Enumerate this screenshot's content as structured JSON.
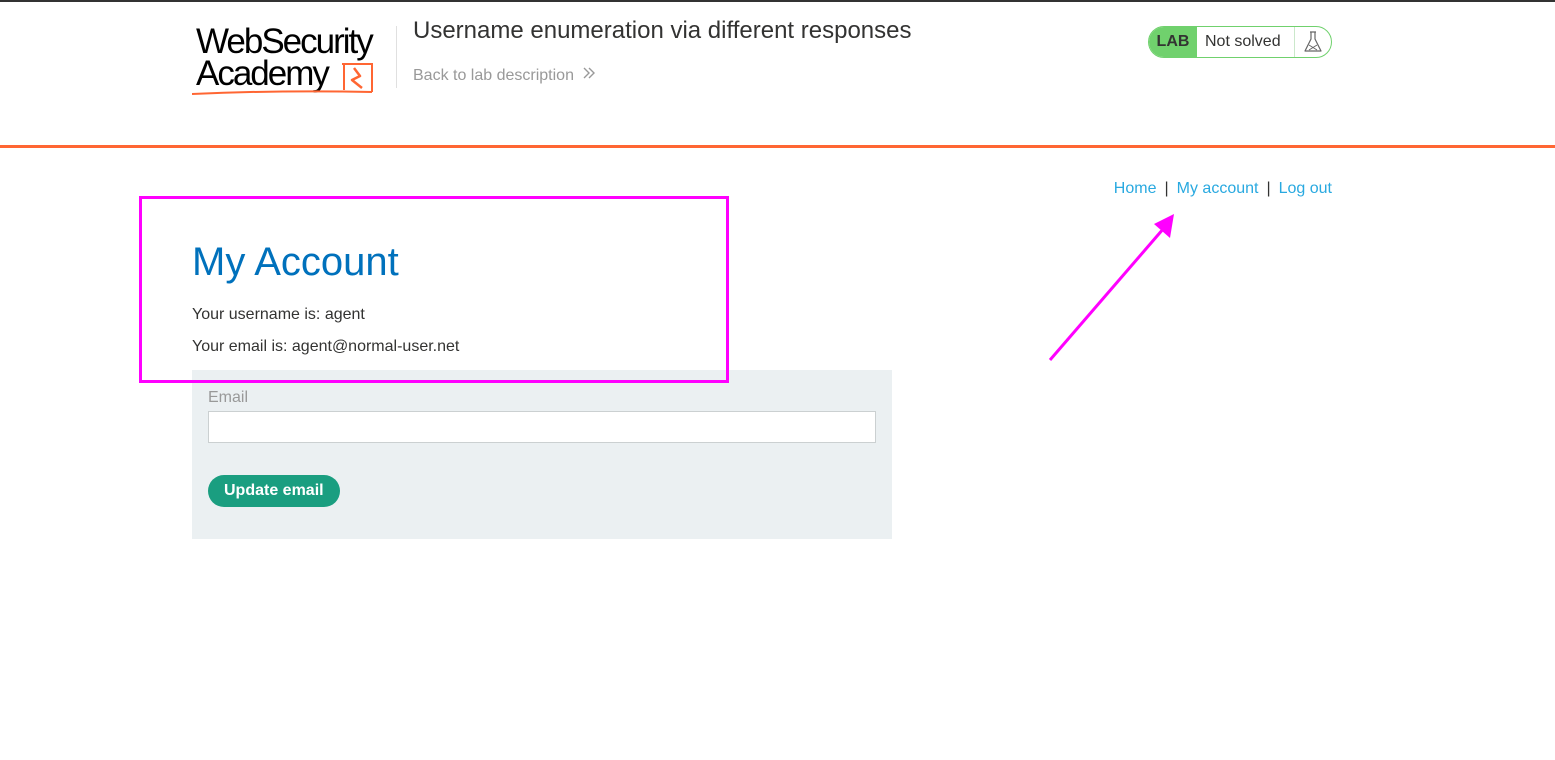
{
  "header": {
    "logo_line1": "WebSecurity",
    "logo_line2": "Academy",
    "lab_title": "Username enumeration via different responses",
    "back_link": "Back to lab description",
    "lab_badge": "LAB",
    "lab_status": "Not solved"
  },
  "nav": {
    "home": "Home",
    "separator": "|",
    "my_account": "My account",
    "log_out": "Log out"
  },
  "main": {
    "heading": "My Account",
    "username_text": "Your username is: agent",
    "email_text": "Your email is: agent@normal-user.net",
    "form": {
      "email_label": "Email",
      "email_value": "",
      "button_label": "Update email"
    }
  },
  "colors": {
    "accent_orange": "#ff6633",
    "heading_blue": "#0071bc",
    "link_blue": "#29a9e0",
    "lab_green": "#70d16d",
    "button_green": "#1a9e80",
    "annotation_magenta": "#ff00ff"
  },
  "icons": {
    "back_chevron": "double-chevron-right-icon",
    "lab_flask": "flask-icon",
    "logo_mark": "lightning-bolt-icon"
  }
}
